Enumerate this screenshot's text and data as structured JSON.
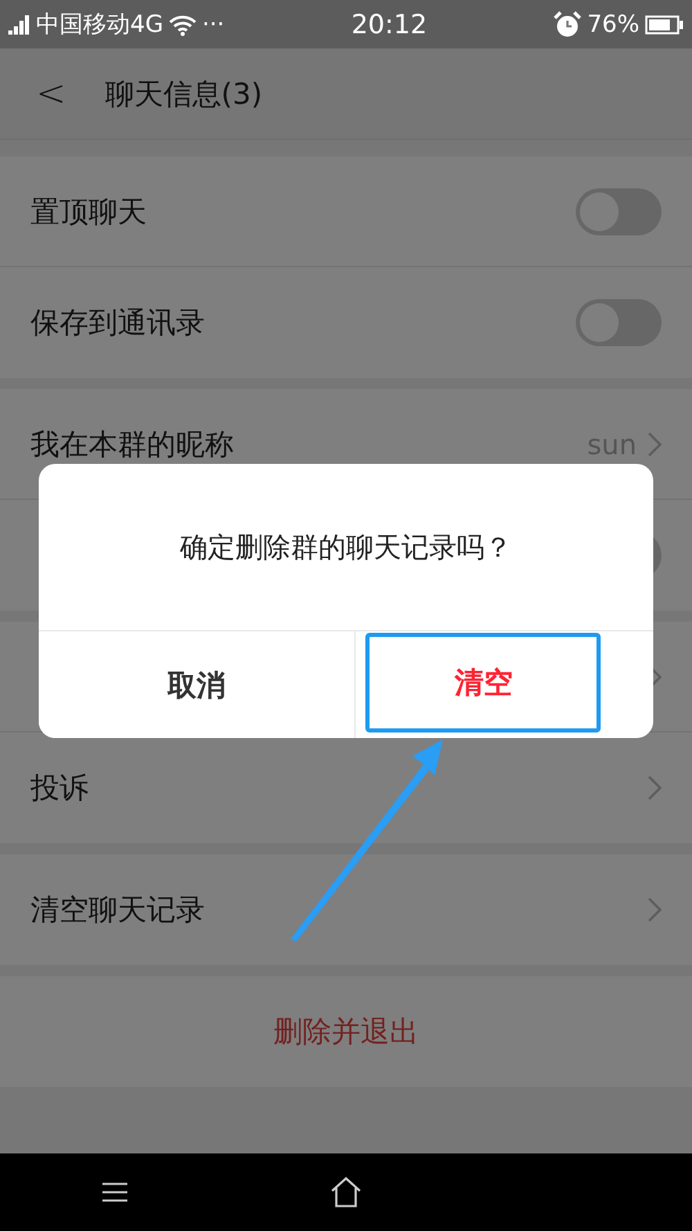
{
  "status_bar": {
    "carrier": "中国移动4G",
    "dots": "···",
    "time": "20:12",
    "battery": "76%"
  },
  "header": {
    "back": "<",
    "title": "聊天信息(3)"
  },
  "sections": [
    {
      "rows": [
        {
          "kind": "toggle",
          "label": "置顶聊天",
          "on": false
        },
        {
          "kind": "toggle",
          "label": "保存到通讯录",
          "on": false
        }
      ]
    },
    {
      "rows": [
        {
          "kind": "link",
          "label": "我在本群的昵称",
          "value": "sun"
        },
        {
          "kind": "toggle",
          "on": false
        }
      ]
    },
    {
      "rows": [
        {
          "kind": "link"
        },
        {
          "kind": "link",
          "label": "投诉"
        }
      ]
    },
    {
      "rows": [
        {
          "kind": "link",
          "label": "清空聊天记录"
        }
      ]
    },
    {
      "rows": [
        {
          "kind": "action",
          "label": "删除并退出"
        }
      ]
    }
  ],
  "dialog": {
    "message": "确定删除群的聊天记录吗？",
    "buttons": [
      {
        "kind": "cancel",
        "label": "取消"
      },
      {
        "kind": "confirm",
        "label": "清空"
      }
    ]
  }
}
